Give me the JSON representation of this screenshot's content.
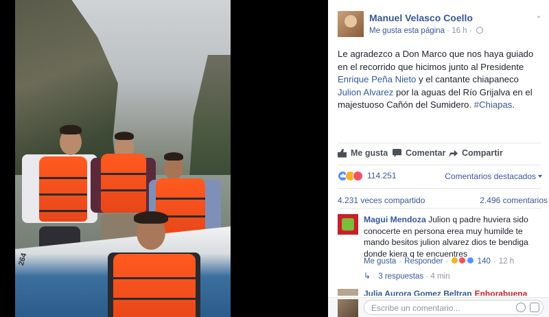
{
  "post": {
    "author": "Manuel Velasco Coello",
    "page_like": "Me gusta esta página",
    "time": "16 h",
    "text_parts": [
      "Le agradezco a Don Marco que nos haya guiado en el recorrido que hicimos junto al Presidente ",
      "Enrique Peña Nieto",
      " y el cantante chiapaneco ",
      "Julion Alvarez",
      " por la aguas del Río Grijalva en el majestuoso Cañón del Sumidero. ",
      "#Chiapas",
      "."
    ],
    "icons": {
      "options": "chevron-down-icon",
      "audience": "globe-icon"
    }
  },
  "photo": {
    "boat_number": "264"
  },
  "actions": {
    "like": "Me gusta",
    "comment": "Comentar",
    "share": "Compartir"
  },
  "reactions": {
    "count": "114.251",
    "types": [
      "like",
      "haha",
      "love"
    ],
    "colors": {
      "like": "#5890ff",
      "haha": "#f7b125",
      "love": "#f25268"
    }
  },
  "sort_label": "Comentarios destacados",
  "stats": {
    "shares": "4.231 veces compartido",
    "comments": "2.496 comentarios"
  },
  "comment": {
    "author": "Magui Mendoza",
    "text": "Julion q padre huviera sido conocerte en persona erea muy humilde te mando besitos julion alvarez dios te bendiga donde kiera q te encuentres",
    "like": "Me gusta",
    "reply": "Responder",
    "reaction_count": "140",
    "time": "12 h",
    "replies": "3 respuestas",
    "replies_time": "4 min"
  },
  "comment2": {
    "author": "Julia Aurora Gomez Beltran",
    "text": "Enhorabuena"
  },
  "composer": {
    "placeholder": "Escribe un comentario..."
  },
  "colors": {
    "link": "#365899",
    "text": "#1d2129",
    "muted": "#90949c"
  }
}
